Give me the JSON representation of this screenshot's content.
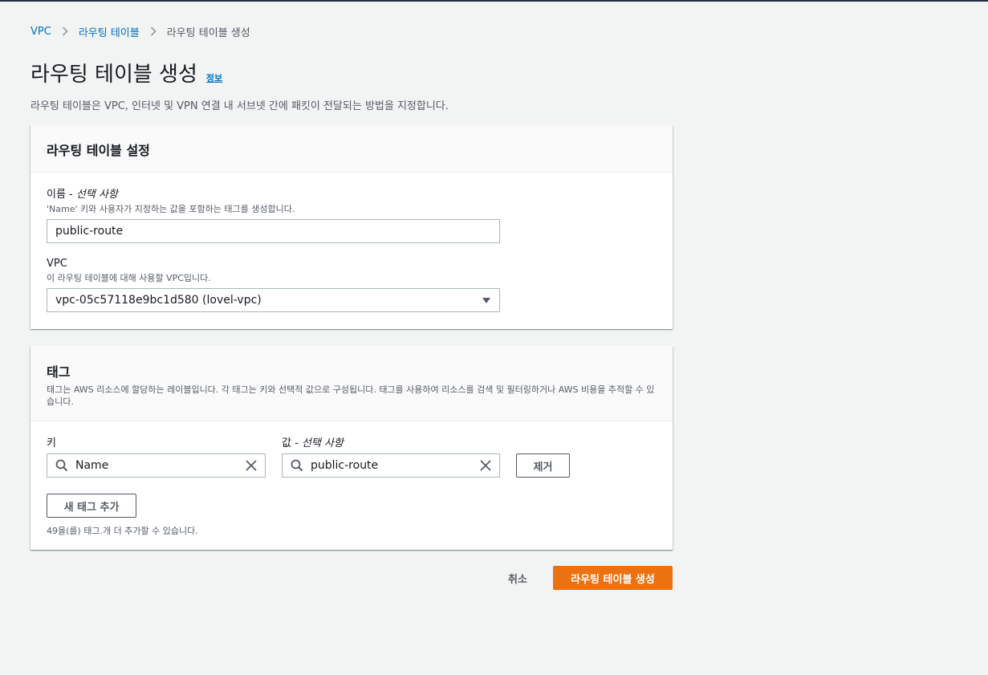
{
  "breadcrumb": {
    "items": [
      "VPC",
      "라우팅 테이블"
    ],
    "current": "라우팅 테이블 생성"
  },
  "header": {
    "title": "라우팅 테이블 생성",
    "info_link": "정보",
    "description": "라우팅 테이블은 VPC, 인터넷 및 VPN 연결 내 서브넷 간에 패킷이 전달되는 방법을 지정합니다."
  },
  "settings_panel": {
    "title": "라우팅 테이블 설정",
    "name_field": {
      "label": "이름 - ",
      "label_optional": "선택 사항",
      "description": "'Name' 키와 사용자가 지정하는 값을 포함하는 태그를 생성합니다.",
      "value": "public-route"
    },
    "vpc_field": {
      "label": "VPC",
      "description": "이 라우팅 테이블에 대해 사용할 VPC입니다.",
      "value": "vpc-05c57118e9bc1d580 (lovel-vpc)"
    }
  },
  "tags_panel": {
    "title": "태그",
    "description": "태그는 AWS 리소스에 할당하는 레이블입니다. 각 태그는 키와 선택적 값으로 구성됩니다. 태그를 사용하여 리소스를 검색 및 필터링하거나 AWS 비용을 추적할 수 있습니다.",
    "key_label": "키",
    "value_label": "값 - ",
    "value_label_optional": "선택 사항",
    "tags": [
      {
        "key": "Name",
        "value": "public-route"
      }
    ],
    "remove_button": "제거",
    "add_button": "새 태그 추가",
    "remaining_note": "49을(를) 태그.개 더 추가할 수 있습니다."
  },
  "footer": {
    "cancel": "취소",
    "create": "라우팅 테이블 생성"
  },
  "colors": {
    "accent": "#ec7211",
    "link": "#0073bb",
    "background": "#f2f3f3"
  }
}
